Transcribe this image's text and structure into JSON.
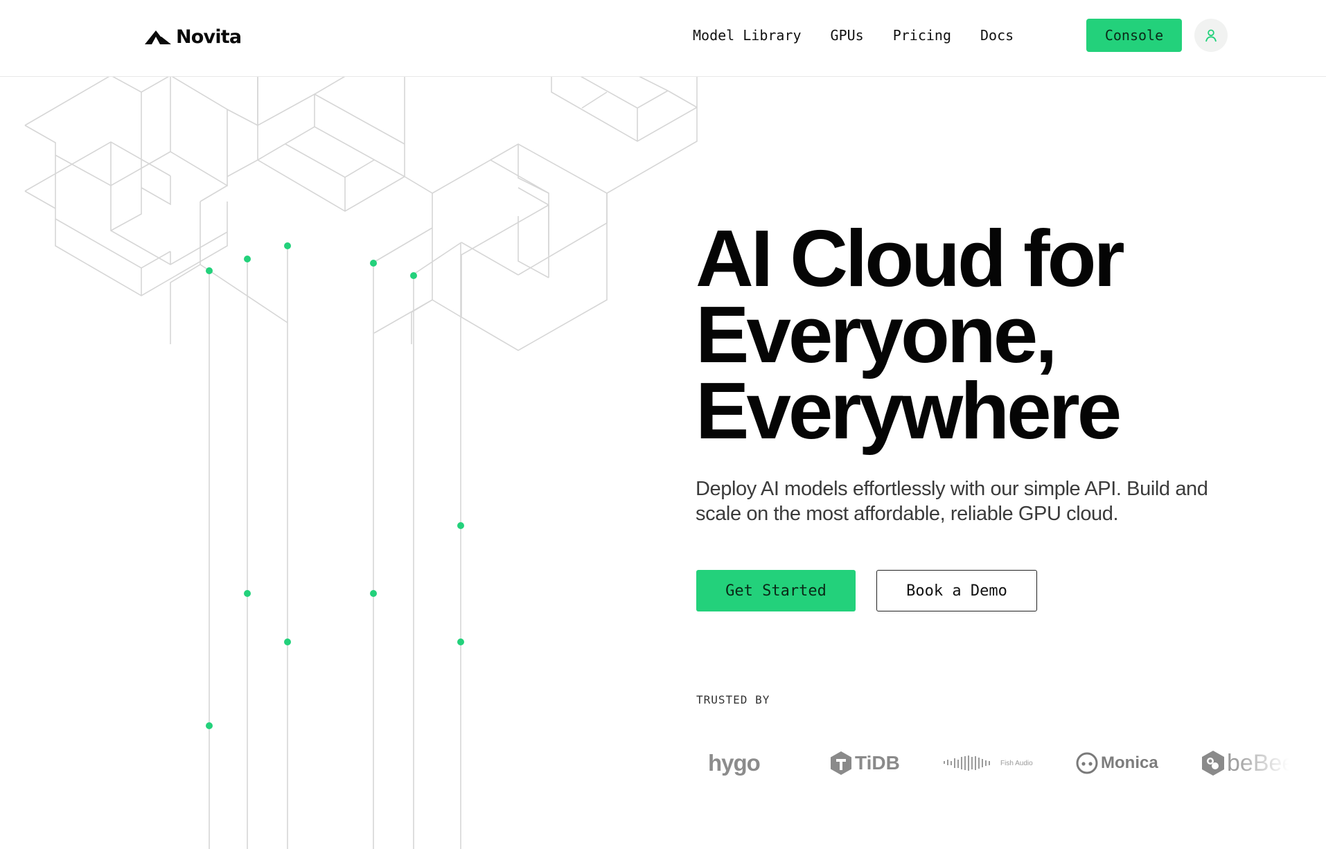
{
  "nav": {
    "brand": "Novita",
    "links": [
      "Model Library",
      "GPUs",
      "Pricing",
      "Docs"
    ],
    "console_label": "Console"
  },
  "hero": {
    "headline_lines": [
      "AI Cloud for",
      "Everyone,",
      "Everywhere"
    ],
    "subtitle": "Deploy AI models effortlessly with our simple API. Build and scale on the most affordable, reliable GPU cloud.",
    "primary_cta": "Get Started",
    "secondary_cta": "Book a Demo"
  },
  "trusted": {
    "label": "TRUSTED BY",
    "logos": [
      {
        "name": "hygo",
        "icon": "hygo-wordmark"
      },
      {
        "name": "TiDB",
        "icon": "tidb-logo"
      },
      {
        "name": "Fish Audio",
        "icon": "fish-audio-waveform"
      },
      {
        "name": "Monica",
        "icon": "monica-face-icon"
      },
      {
        "name": "beBee",
        "icon": "bebee-bee-icon"
      }
    ]
  },
  "colors": {
    "accent": "#23d17b",
    "line": "#d6d6d6",
    "text": "#050505",
    "muted": "#8a8a8a"
  }
}
